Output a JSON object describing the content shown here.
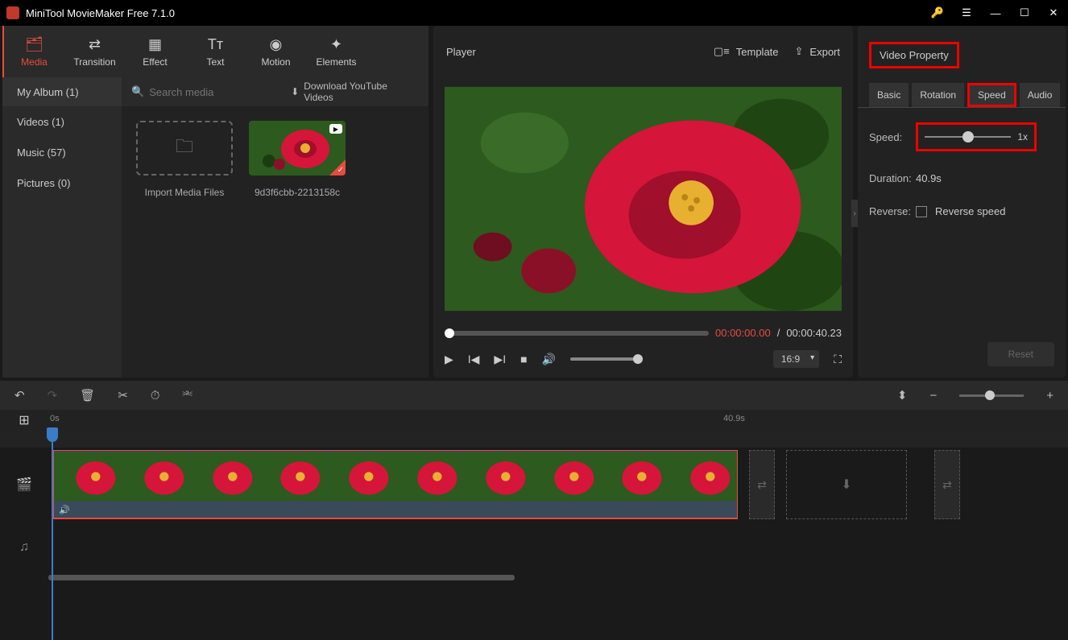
{
  "titlebar": {
    "title": "MiniTool MovieMaker Free 7.1.0"
  },
  "ribbon": {
    "media": "Media",
    "transition": "Transition",
    "effect": "Effect",
    "text": "Text",
    "motion": "Motion",
    "elements": "Elements"
  },
  "album": {
    "tab": "My Album (1)",
    "search_placeholder": "Search media",
    "download_link": "Download YouTube Videos"
  },
  "sidebar": {
    "items": [
      {
        "label": "Videos (1)"
      },
      {
        "label": "Music (57)"
      },
      {
        "label": "Pictures (0)"
      }
    ]
  },
  "media": {
    "import_label": "Import Media Files",
    "clip_label": "9d3f6cbb-2213158c"
  },
  "player": {
    "title": "Player",
    "template_label": "Template",
    "export_label": "Export",
    "current_time": "00:00:00.00",
    "separator": "/",
    "total_time": "00:00:40.23",
    "aspect": "16:9"
  },
  "property": {
    "title": "Video Property",
    "tabs": {
      "basic": "Basic",
      "rotation": "Rotation",
      "speed": "Speed",
      "audio": "Audio"
    },
    "speed_label": "Speed:",
    "speed_value": "1x",
    "duration_label": "Duration:",
    "duration_value": "40.9s",
    "reverse_label": "Reverse:",
    "reverse_text": "Reverse speed",
    "reset_label": "Reset"
  },
  "timeline": {
    "start_mark": "0s",
    "end_mark": "40.9s"
  }
}
